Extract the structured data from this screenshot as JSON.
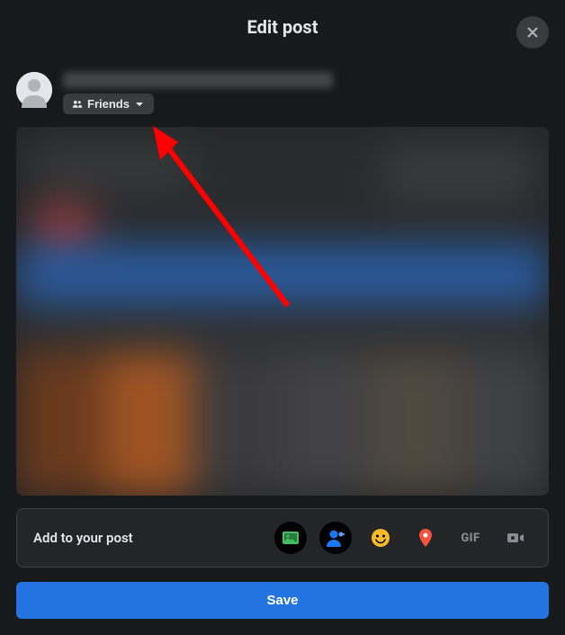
{
  "header": {
    "title": "Edit post"
  },
  "user": {
    "privacy_label": "Friends"
  },
  "add_to_post": {
    "label": "Add to your post",
    "gif_label": "GIF"
  },
  "actions": {
    "save_label": "Save"
  }
}
